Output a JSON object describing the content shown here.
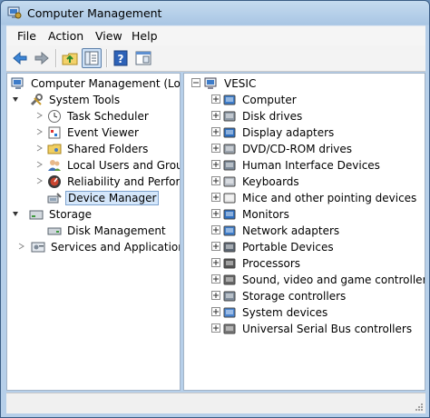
{
  "window": {
    "title": "Computer Management"
  },
  "menu": {
    "file": "File",
    "action": "Action",
    "view": "View",
    "help": "Help"
  },
  "toolbar": {
    "buttons": [
      "back-icon",
      "forward-icon",
      "up-folder-icon",
      "show-hide-tree-icon",
      "help-icon",
      "properties-view-icon"
    ]
  },
  "tree": {
    "root": "Computer Management (Local",
    "system_tools": "System Tools",
    "task_scheduler": "Task Scheduler",
    "event_viewer": "Event Viewer",
    "shared_folders": "Shared Folders",
    "local_users": "Local Users and Groups",
    "reliability": "Reliability and Performa",
    "device_manager": "Device Manager",
    "storage": "Storage",
    "disk_management": "Disk Management",
    "services": "Services and Applications"
  },
  "devices": {
    "root": "VESIC",
    "items": [
      "Computer",
      "Disk drives",
      "Display adapters",
      "DVD/CD-ROM drives",
      "Human Interface Devices",
      "Keyboards",
      "Mice and other pointing devices",
      "Monitors",
      "Network adapters",
      "Portable Devices",
      "Processors",
      "Sound, video and game controllers",
      "Storage controllers",
      "System devices",
      "Universal Serial Bus controllers"
    ]
  },
  "colors": {
    "selection": "#d5e7fb",
    "title_gradient_top": "#c5dbef",
    "pane_border": "#a3b3c6"
  }
}
